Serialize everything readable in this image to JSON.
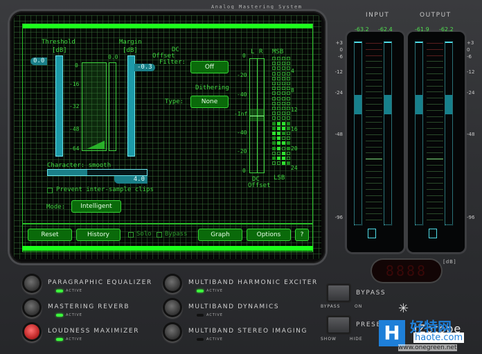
{
  "app": {
    "title": "Analog Mastering System"
  },
  "maximizer": {
    "threshold": {
      "label": "Threshold",
      "unit": "[dB]",
      "value": "0.0"
    },
    "margin": {
      "label": "Margin",
      "unit": "[dB]",
      "value": "-0.3"
    },
    "gr_peak": "0.0",
    "gr_scale": [
      "0",
      "-16",
      "-32",
      "-48",
      "-64"
    ],
    "character": {
      "label": "Character: smooth",
      "value": "4.0",
      "fraction": 0.4
    },
    "prevent_clips": {
      "label": "Prevent inter-sample clips",
      "checked": false
    },
    "mode": {
      "label": "Mode:",
      "value": "Intelligent"
    },
    "dc_offset": {
      "label_lines": [
        "DC",
        "Offset",
        "Filter:"
      ],
      "value": "Off"
    },
    "dithering": {
      "label": "Dithering",
      "type_label": "Type:",
      "value": "None"
    },
    "dc_meter": {
      "channels": [
        "L",
        "R"
      ],
      "scale": [
        "0",
        "-20",
        "-40",
        "-Inf",
        "-40",
        "-20",
        "0"
      ],
      "caption": [
        "DC",
        "Offset"
      ]
    },
    "bit_meter": {
      "top": "MSB",
      "bottom": "LSB",
      "scale": [
        "4",
        "8",
        "12",
        "16",
        "20",
        "24"
      ]
    }
  },
  "toolbar": {
    "reset": "Reset",
    "history": "History",
    "solo": "Solo",
    "bypass": "Bypass",
    "graph": "Graph",
    "options": "Options",
    "help": "?"
  },
  "meters": {
    "input": {
      "label": "INPUT",
      "left": "-63.2",
      "right": "-62.4"
    },
    "output": {
      "label": "OUTPUT",
      "left": "-61.9",
      "right": "-62.2"
    },
    "scale": [
      "+3",
      "0",
      "-6",
      "-12",
      "-24",
      "-48",
      "-96"
    ],
    "unit": "[dB]",
    "lcd": "8888"
  },
  "modules": [
    {
      "name": "PARAGRAPHIC EQUALIZER",
      "status": "ACTIVE",
      "active": true,
      "selected": false
    },
    {
      "name": "MASTERING REVERB",
      "status": "ACTIVE",
      "active": true,
      "selected": false
    },
    {
      "name": "LOUDNESS MAXIMIZER",
      "status": "ACTIVE",
      "active": true,
      "selected": true
    },
    {
      "name": "MULTIBAND HARMONIC EXCITER",
      "status": "ACTIVE",
      "active": true,
      "selected": false
    },
    {
      "name": "MULTIBAND DYNAMICS",
      "status": "ACTIVE",
      "active": false,
      "selected": false
    },
    {
      "name": "MULTIBAND STEREO IMAGING",
      "status": "ACTIVE",
      "active": false,
      "selected": false
    }
  ],
  "global": {
    "bypass": "BYPASS",
    "bypass_opts": [
      "BYPASS",
      "ON"
    ],
    "presets": "PRESETS",
    "preset_opts": [
      "SHOW",
      "HIDE"
    ]
  },
  "brand": "iZotope",
  "watermark": {
    "logo": "H",
    "cn": "好特网",
    "site": "haote.com",
    "url": "www.onegreen.net"
  }
}
